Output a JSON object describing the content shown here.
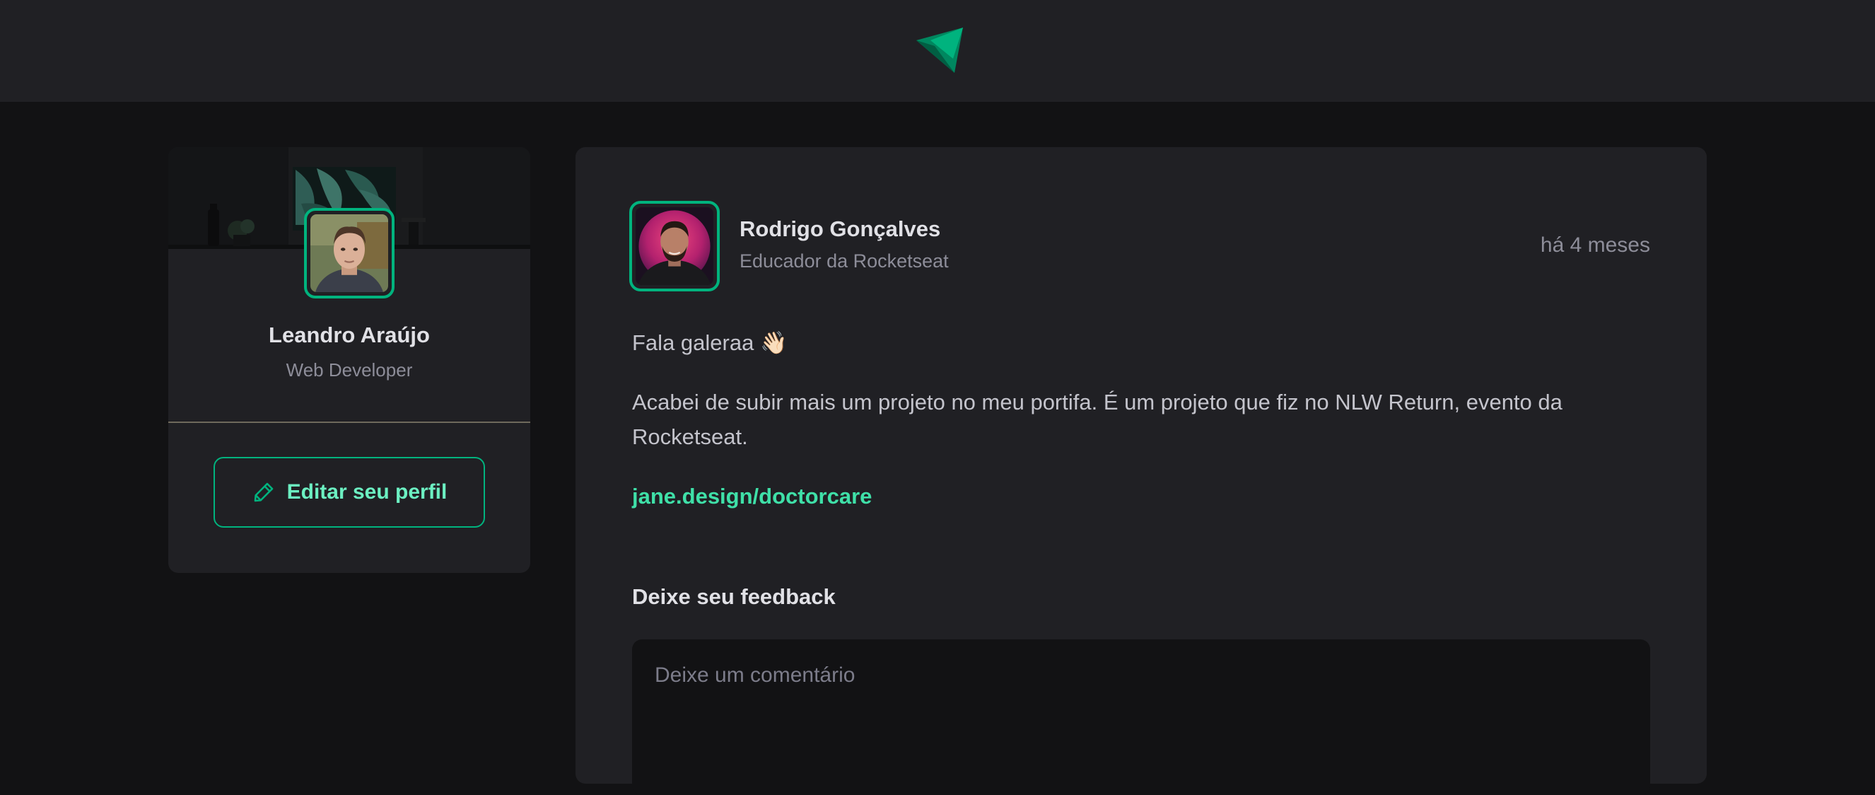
{
  "header": {
    "logo_icon": "ignite-feed-logo-icon",
    "logo_colors": [
      "#00875f",
      "#00b37e"
    ]
  },
  "sidebar": {
    "user": {
      "name": "Leandro Araújo",
      "role": "Web Developer"
    },
    "edit_button": {
      "label": "Editar seu perfil",
      "icon": "pencil-icon"
    }
  },
  "post": {
    "author": {
      "name": "Rodrigo Gonçalves",
      "role": "Educador da Rocketseat"
    },
    "published": "há 4 meses",
    "content": {
      "greeting": "Fala galeraa 👋🏻",
      "paragraph": "Acabei de subir mais um projeto no meu portifa. É um projeto que fiz no NLW Return, evento da Rocketseat.",
      "link": "jane.design/doctorcare"
    },
    "feedback": {
      "title": "Deixe seu feedback",
      "placeholder": "Deixe um comentário",
      "value": ""
    }
  },
  "colors": {
    "background": "#121214",
    "surface": "#202024",
    "accent": "#00b37e",
    "link": "#3fe0a8",
    "text_primary": "#e1e1e6",
    "text_secondary": "#8d8d99"
  }
}
